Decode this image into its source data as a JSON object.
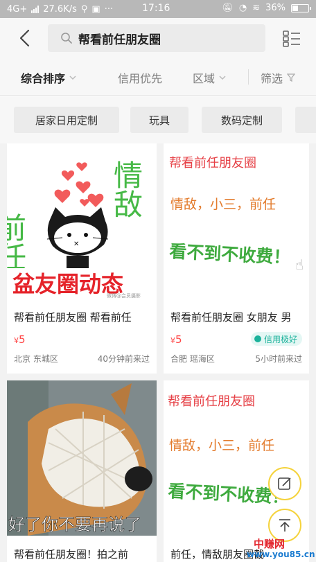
{
  "status_bar": {
    "network": "4G+",
    "speed": "27.6K/s",
    "time": "17:16",
    "battery": "36%",
    "battery_level": 0.36,
    "extra": "···"
  },
  "top_bar": {
    "search_query": "帮看前任朋友圈"
  },
  "sort_bar": {
    "items": [
      "综合排序",
      "信用优先",
      "区域",
      "筛选"
    ]
  },
  "chips": [
    "居家日用定制",
    "玩具",
    "数码定制"
  ],
  "cards": [
    {
      "image_text": {
        "left_vertical": "前任",
        "right_vertical": "情敌",
        "bottom": "盆友圈动态",
        "watermark": "微博@会员摄影"
      },
      "title": "帮看前任朋友圈 帮看前任",
      "price_symbol": "¥",
      "price": "5",
      "location": "北京 东城区",
      "time": "40分钟前来过"
    },
    {
      "image_text": {
        "header": "帮看前任朋友圈",
        "line1": "情敌，小三，前任",
        "line2": "看不到不收费！"
      },
      "title": "帮看前任朋友圈 女朋友 男",
      "price_symbol": "¥",
      "price": "5",
      "badge": "信用极好",
      "location": "合肥 瑶海区",
      "time": "5小时前来过"
    },
    {
      "image_text": {
        "bottom": "好了你不要再说了"
      },
      "title": "帮看前任朋友圈！拍之前"
    },
    {
      "image_text": {
        "header": "帮看前任朋友圈",
        "line1": "情敌，小三，前任",
        "line2": "看不到不收费！"
      },
      "title": "前任，情敌朋友圈截"
    }
  ],
  "watermark": {
    "cn": "中赚网",
    "url": "www.you85.cn"
  },
  "colors": {
    "status_bar": "#b8b8b8",
    "price": "#ff4444",
    "badge_text": "#1bb29b",
    "fab_border": "#f5d33d",
    "poster_header": "#e64046",
    "poster_orange": "#e37b2c",
    "poster_green": "#3eaa3e"
  },
  "icons": [
    "back-arrow-icon",
    "search-icon",
    "grid-list-icon",
    "chevron-down-icon",
    "filter-icon",
    "edit-icon",
    "scroll-top-icon"
  ]
}
